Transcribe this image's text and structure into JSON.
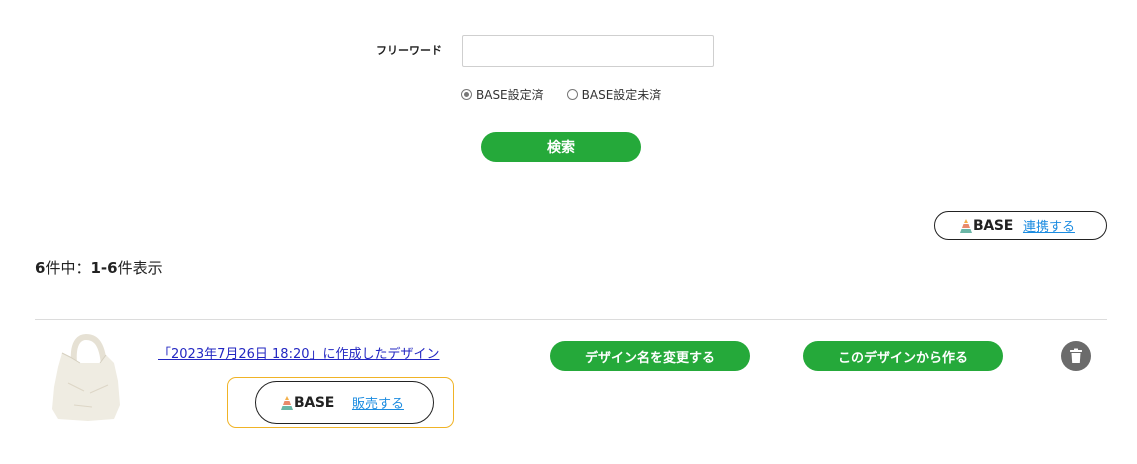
{
  "search": {
    "freeword_label": "フリーワード",
    "freeword_value": "",
    "freeword_placeholder": "",
    "radio_options": [
      {
        "label": "BASE設定済",
        "checked": true
      },
      {
        "label": "BASE設定未済",
        "checked": false
      }
    ],
    "submit_label": "検索"
  },
  "base_connect": {
    "logo_text": "BASE",
    "link_label": "連携する"
  },
  "results": {
    "total": "6",
    "total_suffix": "件中：",
    "range": "1-6",
    "range_suffix": "件表示"
  },
  "items": [
    {
      "title": "「2023年7月26日 18:20」に作成したデザイン",
      "base_logo_text": "BASE",
      "sell_label": "販売する",
      "rename_label": "デザイン名を変更する",
      "create_label": "このデザインから作る",
      "thumbnail": "tote-bag-image"
    }
  ],
  "colors": {
    "accent_green": "#25a93a",
    "link_blue": "#1a8be0",
    "title_link": "#2327c2",
    "sell_frame": "#f0b326",
    "trash_bg": "#6b6b6b"
  },
  "icons": {
    "delete": "trash-icon",
    "base_logo": "base-logo-icon"
  }
}
